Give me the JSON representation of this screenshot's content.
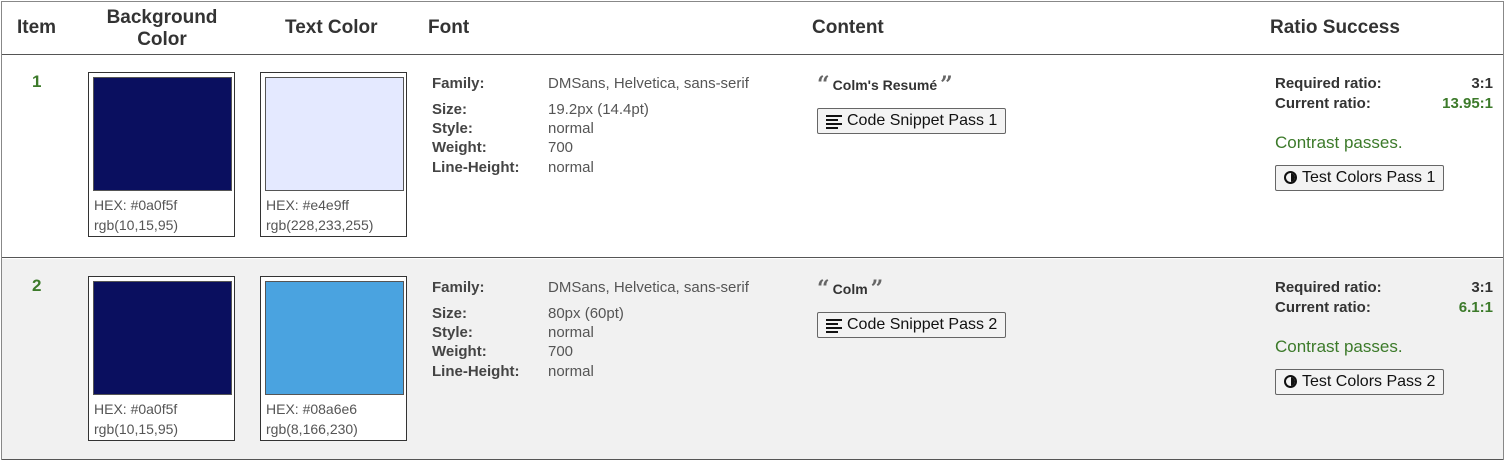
{
  "header": {
    "item": "Item",
    "background_color": "Background Color",
    "text_color": "Text Color",
    "font": "Font",
    "content": "Content",
    "ratio_success": "Ratio Success"
  },
  "labels": {
    "family": "Family:",
    "size": "Size:",
    "style": "Style:",
    "weight": "Weight:",
    "line_height": "Line-Height:",
    "required_ratio": "Required ratio:",
    "current_ratio": "Current ratio:"
  },
  "rows": [
    {
      "item": "1",
      "bg": {
        "hex_label": "HEX: #0a0f5f",
        "rgb_label": "rgb(10,15,95)",
        "color": "#0a0f5f"
      },
      "fg": {
        "hex_label": "HEX: #e4e9ff",
        "rgb_label": "rgb(228,233,255)",
        "color": "#e4e9ff"
      },
      "font": {
        "family": "DMSans, Helvetica, sans-serif",
        "size": "19.2px (14.4pt)",
        "style": "normal",
        "weight": "700",
        "line_height": "normal"
      },
      "content": {
        "quote": "Colm's Resumé",
        "button": "Code Snippet Pass 1"
      },
      "ratio": {
        "required": "3:1",
        "current": "13.95:1",
        "status": "Contrast passes.",
        "button": "Test Colors Pass 1"
      }
    },
    {
      "item": "2",
      "bg": {
        "hex_label": "HEX: #0a0f5f",
        "rgb_label": "rgb(10,15,95)",
        "color": "#0a0f5f"
      },
      "fg": {
        "hex_label": "HEX: #08a6e6",
        "rgb_label": "rgb(8,166,230)",
        "color": "#4aa3e0"
      },
      "font": {
        "family": "DMSans, Helvetica, sans-serif",
        "size": "80px (60pt)",
        "style": "normal",
        "weight": "700",
        "line_height": "normal"
      },
      "content": {
        "quote": "Colm",
        "button": "Code Snippet Pass 2"
      },
      "ratio": {
        "required": "3:1",
        "current": "6.1:1",
        "status": "Contrast passes.",
        "button": "Test Colors Pass 2"
      }
    }
  ],
  "icons": {
    "quote_open": "quote-open-icon",
    "quote_close": "quote-close-icon",
    "code_snippet": "lines-icon",
    "test_colors": "contrast-icon"
  },
  "colors": {
    "pass_green": "#3c7a2a",
    "row_alt_bg": "#f1f1f1"
  }
}
